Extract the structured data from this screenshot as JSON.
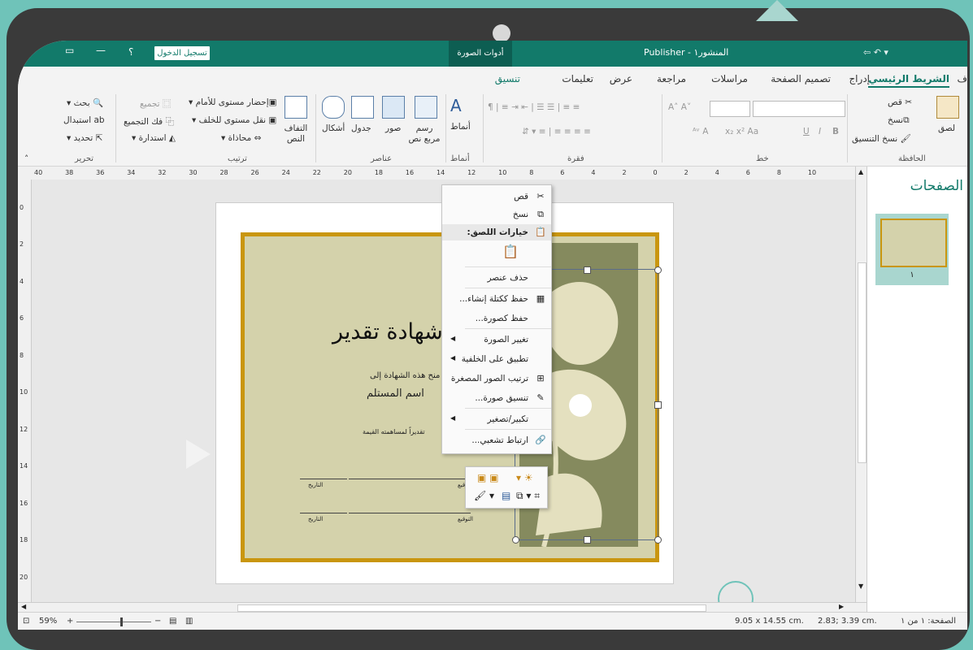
{
  "titlebar": {
    "title": "المنشور١ - Publisher",
    "tools_label": "أدوات الصورة",
    "signin_label": "تسجيل الدخول",
    "help_label": "؟",
    "minimize_label": "—",
    "qat_label": "⇦ ↶ ▾",
    "accent_color": "#127a6a"
  },
  "tabs": {
    "file": "ف",
    "home": "الشريط الرئيسي",
    "insert": "إدراج",
    "page_design": "تصميم الصفحة",
    "mailings": "مراسلات",
    "review": "مراجعة",
    "view": "عرض",
    "help": "تعليمات",
    "format": "تنسيق"
  },
  "ribbon": {
    "clipboard": {
      "paste": "لصق",
      "cut": "قص",
      "copy": "نسخ",
      "format_painter": "نسخ التنسيق",
      "group": "الحافظة"
    },
    "font": {
      "group": "خط",
      "bold": "B",
      "italic": "I",
      "underline": "U",
      "size_up": "A",
      "size_down": "A",
      "aa": "Aa"
    },
    "paragraph": {
      "group": "فقرة"
    },
    "styles": {
      "styles": "أنماط",
      "group": "أنماط"
    },
    "objects": {
      "text_box": "رسم مربع نص",
      "pictures": "صور",
      "table": "جدول",
      "shapes": "أشكال",
      "group": "عناصر"
    },
    "arrange": {
      "wrap_text": "التفاف النص",
      "bring_forward": "إحضار مستوى للأمام",
      "send_backward": "نقل مستوى للخلف",
      "align": "محاذاة",
      "group_btn": "تجميع",
      "ungroup": "فك التجميع",
      "rotate": "استدارة",
      "group": "ترتيب"
    },
    "editing": {
      "find": "بحث",
      "replace": "استبدال",
      "select": "تحديد",
      "group": "تحرير"
    }
  },
  "ruler": {
    "h_ticks": [
      "40",
      "38",
      "36",
      "34",
      "32",
      "30",
      "28",
      "26",
      "24",
      "22",
      "20",
      "18",
      "16",
      "14",
      "12",
      "10",
      "8",
      "6",
      "4",
      "2",
      "0",
      "2",
      "4",
      "6",
      "8",
      "10"
    ],
    "v_ticks": [
      "0",
      "2",
      "4",
      "6",
      "8",
      "10",
      "12",
      "14",
      "16",
      "18",
      "20"
    ]
  },
  "certificate": {
    "title": "شهادة تقدير",
    "line1": "تم منح هذه الشهادة إلى",
    "recipient": "اسم المستلم",
    "line3": "تقديراً لمساهمته القيمة",
    "date_label": "التاريخ",
    "sign_label": "التوقيع",
    "border_color": "#c9960f",
    "bg_color": "#d4d2ab",
    "art_color": "#858a5e"
  },
  "context_menu": {
    "cut": "قص",
    "copy": "نسخ",
    "paste_options": "خيارات اللصق:",
    "delete": "حذف عنصر",
    "save_building_block": "حفظ ككتلة إنشاء...",
    "save_as_picture": "حفظ كصورة...",
    "change_picture": "تغيير الصورة",
    "apply_to_background": "تطبيق على الخلفية",
    "arrange_thumbnails": "ترتيب الصور المصغرة",
    "format_picture": "تنسيق صورة...",
    "zoom": "تكبير/تصغير",
    "hyperlink": "ارتباط تشعبي..."
  },
  "pages_pane": {
    "title": "الصفحات",
    "page_number": "١"
  },
  "status": {
    "zoom": "59%",
    "size": "9.05 x 14.55 cm.",
    "position": "2.83; 3.39 cm.",
    "page": "الصفحة: ١ من ١"
  }
}
